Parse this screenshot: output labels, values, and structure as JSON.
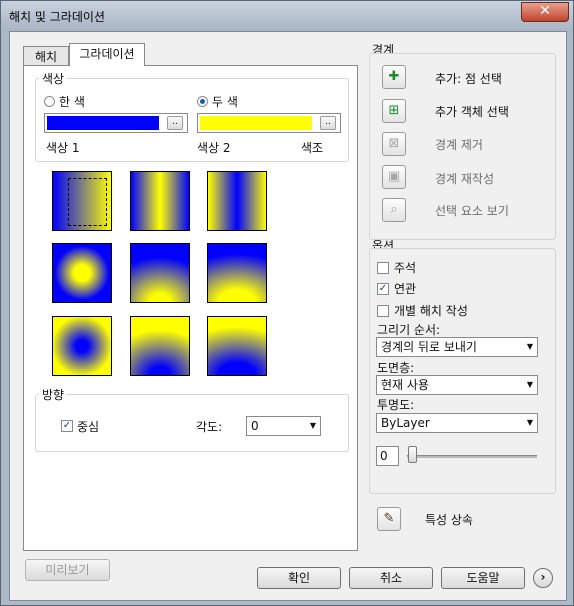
{
  "window": {
    "title": "해치 및 그라데이션",
    "close_label": "✕"
  },
  "tabs": [
    {
      "label": "해치",
      "active": false
    },
    {
      "label": "그라데이션",
      "active": true
    }
  ],
  "color_group": {
    "title": "색상",
    "one_color": {
      "label": "한 색",
      "selected": false
    },
    "two_color": {
      "label": "두 색",
      "selected": true
    },
    "color1": {
      "swatch": "#0000ff",
      "button": "..",
      "label": "색상 1"
    },
    "color2": {
      "swatch": "#ffff00",
      "button": "..",
      "label": "색상 2"
    },
    "tint_label": "색조"
  },
  "patterns": [
    "linear-left",
    "cylinder-vertical",
    "inverse-cylinder-vertical",
    "spherical",
    "hemispherical",
    "curved",
    "inverse-spherical",
    "inverse-hemispherical",
    "inverse-curved"
  ],
  "orientation": {
    "title": "방향",
    "centered": {
      "label": "중심",
      "checked": true
    },
    "angle_label": "각도:",
    "angle_value": "0"
  },
  "boundaries": {
    "title": "경계",
    "items": [
      {
        "label": "추가: 점 선택",
        "icon": "pick-points-icon",
        "enabled": true
      },
      {
        "label": "추가 객체 선택",
        "icon": "select-objects-icon",
        "enabled": true
      },
      {
        "label": "경계 제거",
        "icon": "remove-boundaries-icon",
        "enabled": false
      },
      {
        "label": "경계 재작성",
        "icon": "recreate-boundary-icon",
        "enabled": false
      },
      {
        "label": "선택 요소 보기",
        "icon": "view-selections-icon",
        "enabled": false
      }
    ]
  },
  "options": {
    "title": "옵션",
    "annotative": {
      "label": "주석",
      "checked": false
    },
    "associative": {
      "label": "연관",
      "checked": true
    },
    "separate": {
      "label": "개별 해치 작성",
      "checked": false
    },
    "draw_order_label": "그리기 순서:",
    "draw_order_value": "경계의 뒤로 보내기",
    "layer_label": "도면층:",
    "layer_value": "현재 사용",
    "transparency_label": "투명도:",
    "transparency_value": "ByLayer",
    "transparency_number": "0",
    "slider_level": 0
  },
  "inherit": {
    "label": "특성 상속"
  },
  "buttons": {
    "preview": "미리보기",
    "ok": "확인",
    "cancel": "취소",
    "help": "도움말",
    "more": "›"
  }
}
